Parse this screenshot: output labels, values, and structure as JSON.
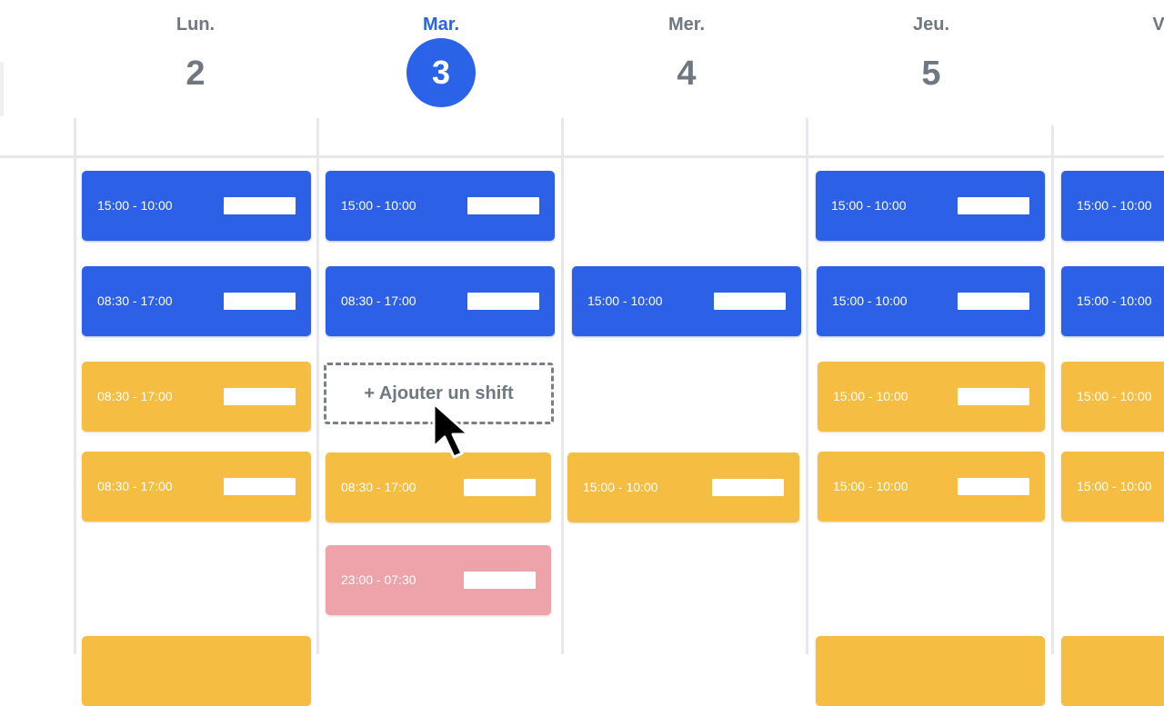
{
  "days": [
    {
      "name": "Lun.",
      "number": "2"
    },
    {
      "name": "Mar.",
      "number": "3"
    },
    {
      "name": "Mer.",
      "number": "4"
    },
    {
      "name": "Jeu.",
      "number": "5"
    },
    {
      "name": "V",
      "number": ""
    }
  ],
  "shifts": {
    "lun_1": "15:00 - 10:00",
    "lun_2": "08:30 - 17:00",
    "lun_3": "08:30 - 17:00",
    "lun_4": "08:30 - 17:00",
    "mar_1": "15:00 - 10:00",
    "mar_2": "08:30 - 17:00",
    "mar_4": "08:30 - 17:00",
    "mar_5": "23:00 - 07:30",
    "mer_2": "15:00 - 10:00",
    "mer_4": "15:00 - 10:00",
    "jeu_1": "15:00 - 10:00",
    "jeu_2": "15:00 - 10:00",
    "jeu_3": "15:00 - 10:00",
    "jeu_4": "15:00 - 10:00",
    "ven_1": "15:00 - 10:00",
    "ven_2": "15:00 - 10:00",
    "ven_3": "15:00 - 10:00",
    "ven_4": "15:00 - 10:00"
  },
  "add_shift_label": "+ Ajouter un shift",
  "colors": {
    "blue": "#2c60e7",
    "yellow": "#f5bd41",
    "pink": "#eea2a9",
    "today": "#2b63e8",
    "header_text": "#6f7780"
  },
  "cursor_icon": "arrow-cursor-icon"
}
